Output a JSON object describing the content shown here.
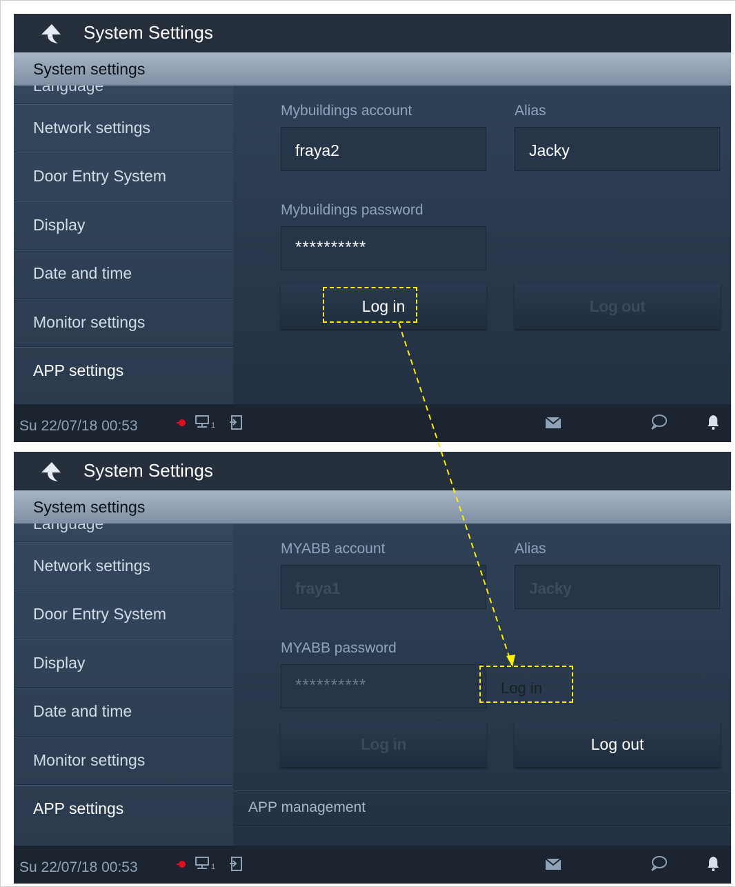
{
  "screens": [
    {
      "title": "System Settings",
      "section": "System settings",
      "sidebar": {
        "partial_item": "Language",
        "items": [
          "Network settings",
          "Door Entry System",
          "Display",
          "Date and time",
          "Monitor settings",
          "APP settings"
        ],
        "active_item": "APP settings"
      },
      "content": {
        "account_label": "Mybuildings account",
        "account_value": "fraya2",
        "alias_label": "Alias",
        "alias_value": "Jacky",
        "password_label": "Mybuildings password",
        "password_value": "**********",
        "login_label": "Log in",
        "logout_label": "Log out"
      },
      "status": {
        "datetime": "Su 22/07/18   00:53",
        "net_subscript": "1"
      }
    },
    {
      "title": "System Settings",
      "section": "System settings",
      "sidebar": {
        "partial_item": "Language",
        "items": [
          "Network settings",
          "Door Entry System",
          "Display",
          "Date and time",
          "Monitor settings",
          "APP settings"
        ],
        "active_item": "APP settings"
      },
      "content": {
        "account_label": "MYABB account",
        "account_value": "fraya1",
        "alias_label": "Alias",
        "alias_value": "Jacky",
        "password_label": "MYABB password",
        "password_value": "**********",
        "login_label": "Log in",
        "logout_label": "Log out",
        "app_management": "APP management"
      },
      "status": {
        "datetime": "Su 22/07/18   00:53",
        "net_subscript": "1"
      }
    }
  ],
  "annotation": {
    "text": "Log in",
    "color": "#ffef00"
  }
}
